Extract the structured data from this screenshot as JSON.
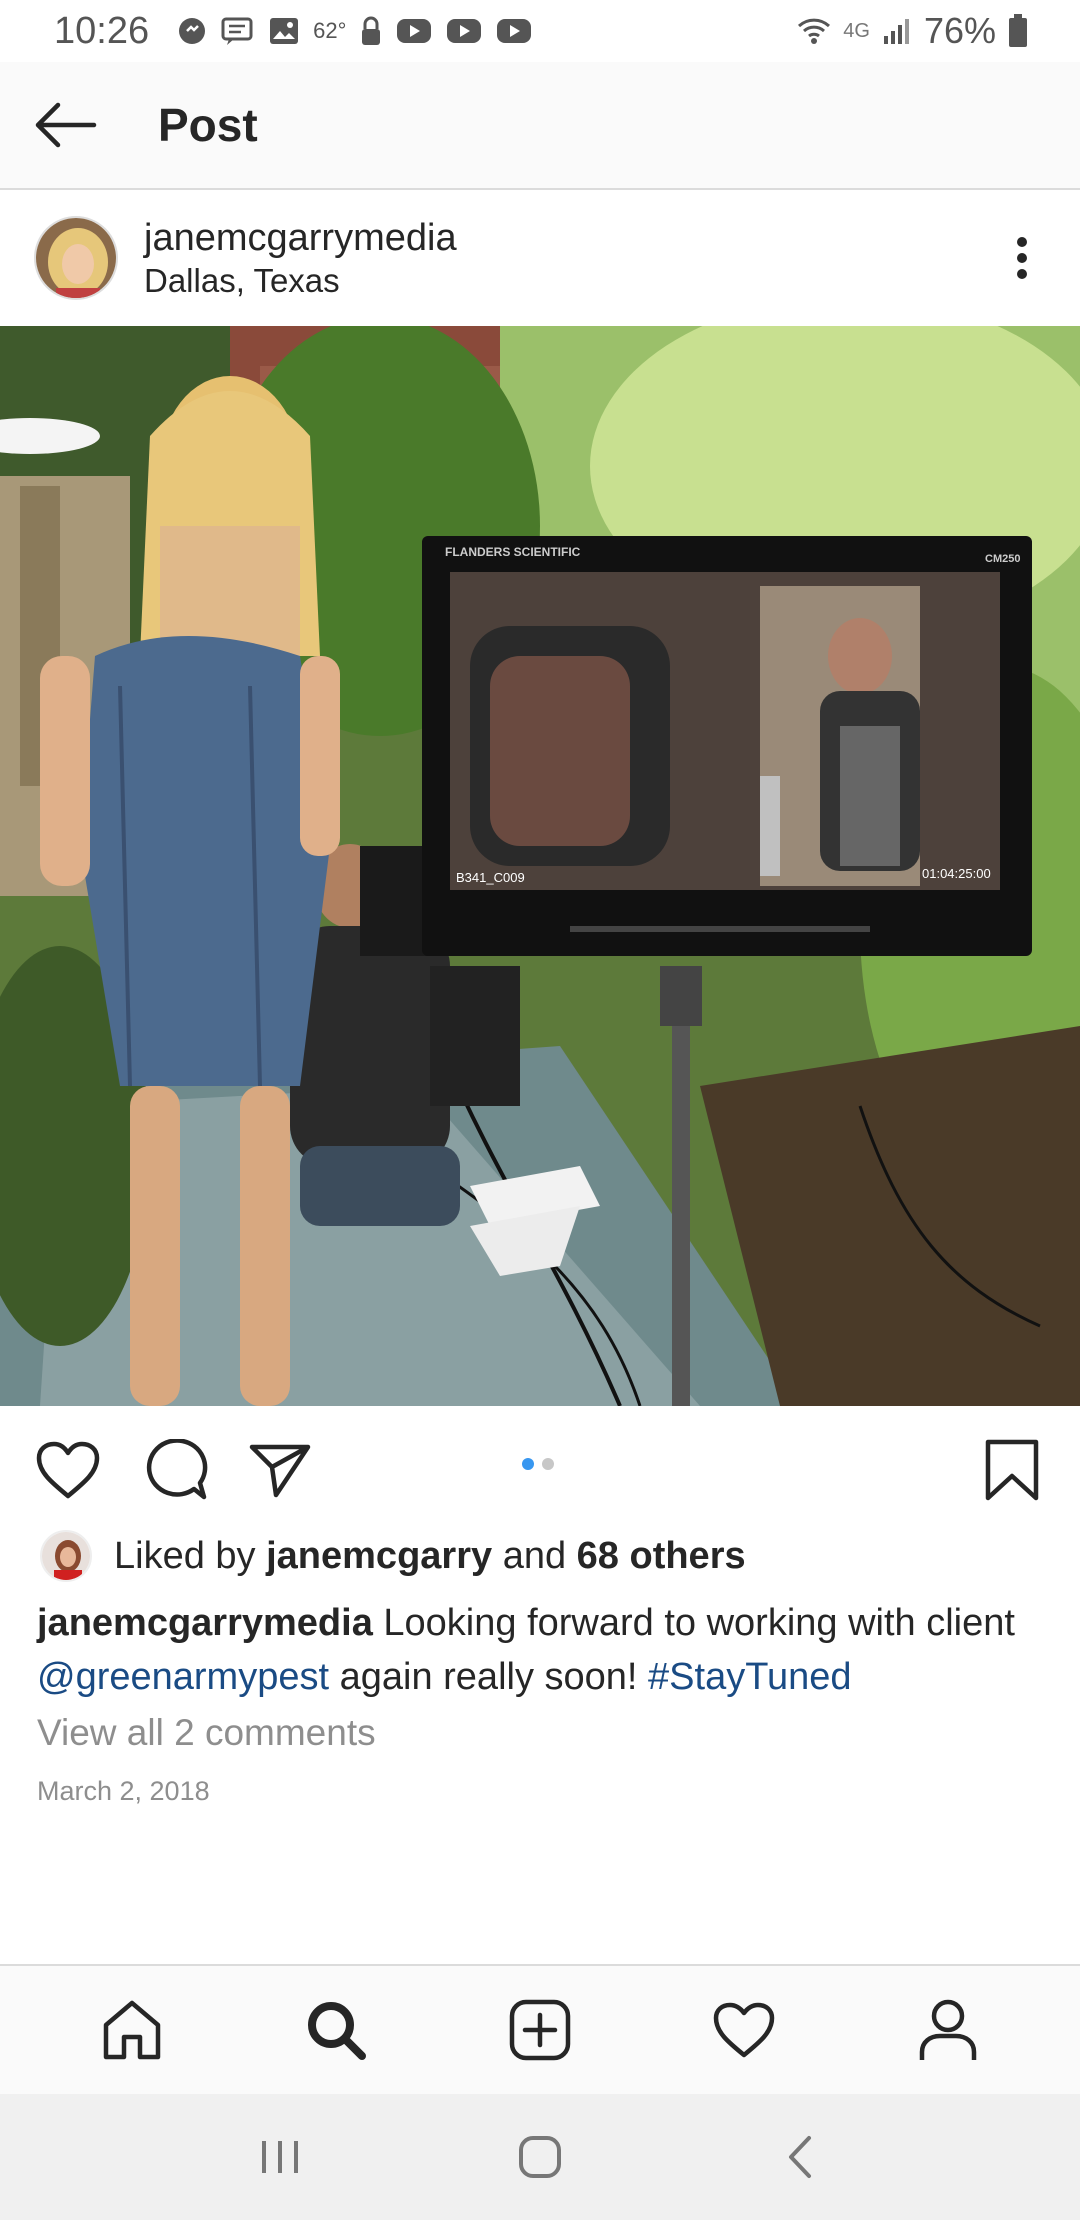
{
  "status_bar": {
    "time": "10:26",
    "temperature": "62°",
    "network": "4G",
    "battery": "76%"
  },
  "header": {
    "title": "Post",
    "back_icon": "arrow-left-icon"
  },
  "post": {
    "author": "janemcgarrymedia",
    "location": "Dallas, Texas",
    "more_icon": "more-vertical-icon",
    "photo": {
      "monitor_brand": "FLANDERS SCIENTIFIC",
      "monitor_model": "CM250",
      "clip_id": "B341_C009",
      "timecode": "01:04:25:00"
    },
    "carousel_dots": 2,
    "active_dot": 0,
    "likes": {
      "prefix": "Liked by",
      "user": "janemcgarry",
      "connector": "and",
      "others": "68 others"
    },
    "caption": {
      "username": "janemcgarrymedia",
      "text_before": "Looking forward to working with client",
      "mention": "@greenarmypest",
      "text_after": "again really soon!",
      "hashtag": "#StayTuned"
    },
    "view_comments": "View all 2 comments",
    "date": "March 2, 2018"
  },
  "bottom_nav": [
    "home-icon",
    "search-icon",
    "add-post-icon",
    "activity-heart-icon",
    "profile-icon"
  ],
  "active_nav": "search-icon",
  "colors": {
    "link": "#1a4b84",
    "secondary_text": "#8e8e8e",
    "active_dot": "#3897f0",
    "inactive_dot": "#c7c7c7"
  }
}
